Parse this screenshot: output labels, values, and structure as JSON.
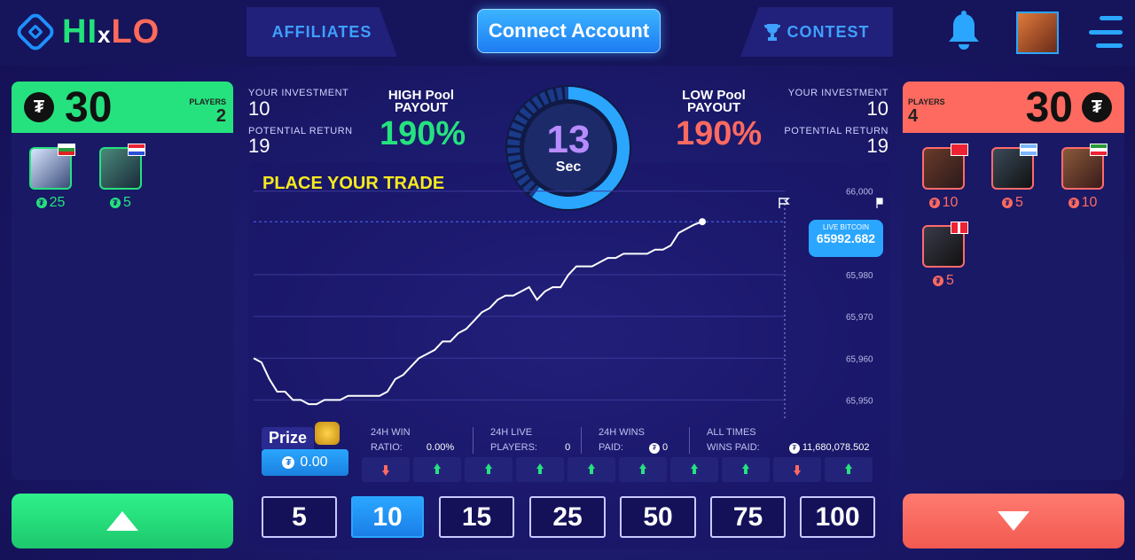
{
  "brand": {
    "name_hi": "HI",
    "name_x": "x",
    "name_lo": "LO"
  },
  "nav": {
    "affiliates": "AFFILIATES",
    "connect": "Connect Account",
    "contest": "CONTEST"
  },
  "left_panel": {
    "total": "30",
    "players_label": "PLAYERS",
    "players_count": "2",
    "players": [
      {
        "amount": "25",
        "flag_colors": [
          "#ffffff",
          "#2b9a3a",
          "#d22"
        ]
      },
      {
        "amount": "5",
        "flag_colors": [
          "#e23",
          "#ffffff",
          "#2a4fd6"
        ]
      }
    ]
  },
  "right_panel": {
    "total": "30",
    "players_label": "PLAYERS",
    "players_count": "4",
    "players": [
      {
        "amount": "10",
        "flag_colors": [
          "#e23",
          "#e23",
          "#f5d10a"
        ]
      },
      {
        "amount": "5",
        "flag_colors": [
          "#7ab6ff",
          "#ffffff",
          "#7ab6ff"
        ]
      },
      {
        "amount": "10",
        "flag_colors": [
          "#2b9a3a",
          "#ffffff",
          "#e23"
        ]
      },
      {
        "amount": "5",
        "flag_colors": [
          "#e23",
          "#ffffff",
          "#e23"
        ]
      }
    ]
  },
  "stats_left": {
    "investment_label": "YOUR INVESTMENT",
    "investment": "10",
    "return_label": "POTENTIAL RETURN",
    "return": "19",
    "pool_label_1": "HIGH Pool",
    "pool_label_2": "PAYOUT",
    "pool_value": "190%"
  },
  "stats_right": {
    "investment_label": "YOUR INVESTMENT",
    "investment": "10",
    "return_label": "POTENTIAL RETURN",
    "return": "19",
    "pool_label_1": "LOW Pool",
    "pool_label_2": "PAYOUT",
    "pool_value": "190%"
  },
  "timer": {
    "value": "13",
    "unit": "Sec"
  },
  "trade_prompt": "PLACE YOUR TRADE",
  "live": {
    "label": "LIVE BITCOIN",
    "value": "65992.682"
  },
  "chart_data": {
    "type": "line",
    "title": "",
    "xlabel": "",
    "ylabel": "",
    "ylim": [
      65945,
      66001
    ],
    "ytick_labels": [
      "66,000",
      "65,980",
      "65,970",
      "65,960",
      "65,950"
    ],
    "yticks": [
      66000,
      65980,
      65970,
      65960,
      65950
    ],
    "series": [
      {
        "values": [
          65960,
          65959,
          65955,
          65952,
          65952,
          65950,
          65950,
          65949,
          65949,
          65950,
          65950,
          65950,
          65951,
          65951,
          65951,
          65951,
          65951,
          65952,
          65955,
          65956,
          65958,
          65960,
          65961,
          65962,
          65964,
          65964,
          65966,
          65967,
          65969,
          65971,
          65972,
          65974,
          65975,
          65975,
          65976,
          65977,
          65974,
          65976,
          65977,
          65977,
          65980,
          65982,
          65982,
          65982,
          65983,
          65984,
          65984,
          65985,
          65985,
          65985,
          65985,
          65986,
          65986,
          65987,
          65990,
          65991,
          65992,
          65992.682
        ]
      }
    ]
  },
  "prize": {
    "label": "Prize",
    "value": "0.00"
  },
  "stats24": {
    "win_label_1": "24H WIN",
    "win_label_2": "RATIO:",
    "win_value": "0.00%",
    "live_label_1": "24H LIVE",
    "live_label_2": "PLAYERS:",
    "live_value": "0",
    "wins_label_1": "24H WINS",
    "wins_label_2": "PAID:",
    "wins_value": "0",
    "all_label_1": "ALL TIMES",
    "all_label_2": "WINS PAID:",
    "all_value": "11,680,078.502"
  },
  "history": [
    "down",
    "up",
    "up",
    "up",
    "up",
    "up",
    "up",
    "up",
    "down",
    "up"
  ],
  "history_colors": {
    "up": "#25e27e",
    "down": "#ff6a60"
  },
  "bets": [
    "5",
    "10",
    "15",
    "25",
    "50",
    "75",
    "100"
  ],
  "bet_selected": "10",
  "tether_glyph": "₮",
  "colors": {
    "green": "#25e27e",
    "red": "#ff6a60",
    "blue": "#2aa6ff",
    "yellow": "#f5ea1e"
  }
}
